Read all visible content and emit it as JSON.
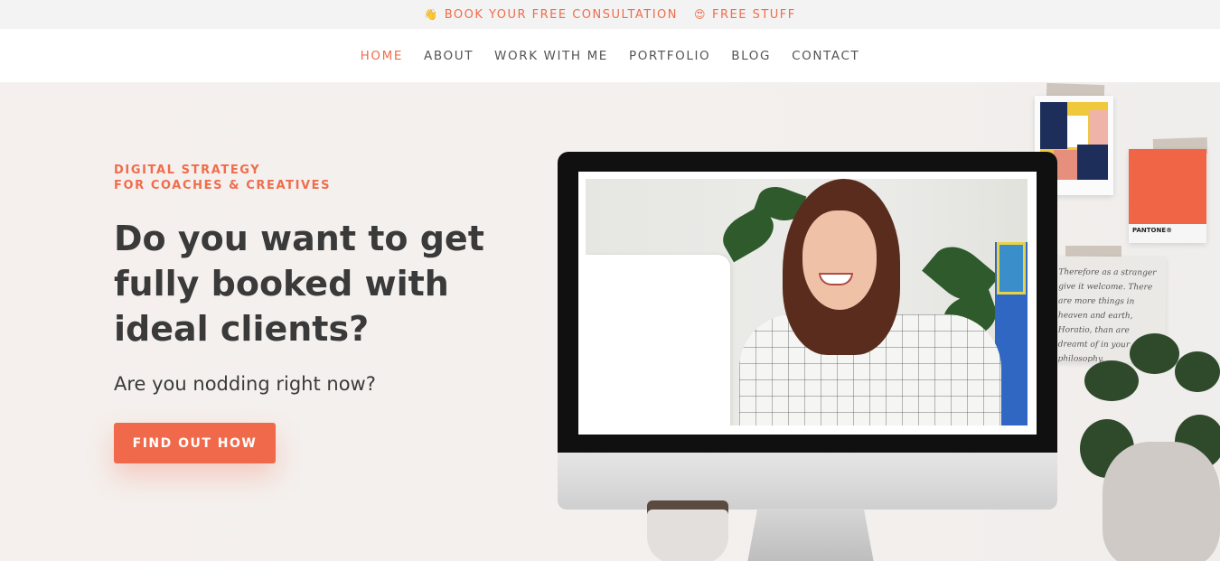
{
  "topbar": {
    "consult": {
      "emoji": "👋",
      "label": "BOOK YOUR FREE CONSULTATION"
    },
    "freebie": {
      "emoji": "😍",
      "label": "FREE STUFF"
    }
  },
  "nav": {
    "items": [
      "HOME",
      "ABOUT",
      "WORK WITH ME",
      "PORTFOLIO",
      "BLOG",
      "CONTACT"
    ],
    "active": "HOME"
  },
  "hero": {
    "eyebrow_line1": "DIGITAL STRATEGY",
    "eyebrow_line2": "FOR COACHES & CREATIVES",
    "headline": "Do you want to get fully booked with ideal clients?",
    "subheading": "Are you nodding right now?",
    "cta_label": "FIND OUT HOW"
  },
  "decor": {
    "pantone_label": "PANTONE®",
    "note_text": "Therefore as a stranger give it welcome. There are more things in heaven and earth, Horatio, than are dreamt of in your philosophy."
  },
  "colors": {
    "accent": "#ef6d4c",
    "button": "#f0694a",
    "text": "#3a3a3a"
  }
}
